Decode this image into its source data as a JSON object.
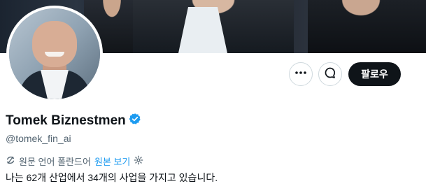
{
  "profile": {
    "display_name": "Tomek Biznestmen",
    "handle": "@tomek_fin_ai",
    "bio": "나는 62개 산업에서 34개의 사업을 가지고 있습니다.",
    "verified_icon": "verified-badge-icon"
  },
  "translation": {
    "source_label": "원문 언어 폴란드어",
    "view_original_label": "원본 보기"
  },
  "actions": {
    "follow_label": "팔로우",
    "more_icon": "more-icon",
    "message_icon": "message-icon"
  },
  "colors": {
    "accent": "#1d9bf0",
    "button_dark": "#0f1419",
    "secondary_text": "#536471"
  }
}
